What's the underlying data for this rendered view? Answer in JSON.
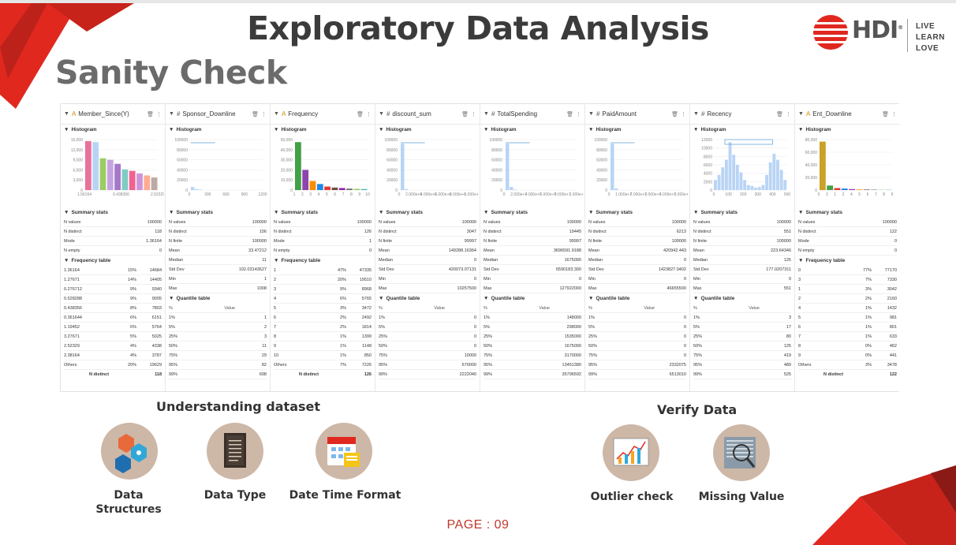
{
  "title": "Exploratory Data Analysis",
  "subtitle": "Sanity Check",
  "logo": {
    "brand": "HDI",
    "reg": "®",
    "slogan": [
      "LIVE",
      "LEARN",
      "LOVE"
    ]
  },
  "colors": {
    "accent_red": "#e0281f",
    "dark_red": "#8b1a16",
    "icon_bg": "#cdb7a7",
    "bar_blue": "#b8d4f5"
  },
  "labels": {
    "histogram": "Histogram",
    "summary_stats": "Summary stats",
    "frequency_table": "Frequency table",
    "quantile_table": "Quantile table",
    "pct_header": "%",
    "value_header": "Value",
    "n_distinct": "N distinct"
  },
  "columns": [
    {
      "name": "Member_Since(Y)",
      "type_icon": "A",
      "hist_ticks": [
        "1.56164",
        "0.438356",
        "2.52329"
      ],
      "y_ticks": [
        "15,000",
        "12,000",
        "9,000",
        "6,000",
        "3,000",
        "0"
      ],
      "summary": [
        [
          "N values",
          "100000"
        ],
        [
          "N distinct",
          "118"
        ],
        [
          "Mode",
          "1.36164"
        ],
        [
          "N empty",
          "0"
        ]
      ],
      "frequency": [
        [
          "1.36164",
          "15%",
          "14684"
        ],
        [
          "1.27671",
          "14%",
          "14405"
        ],
        [
          "0.276712",
          "9%",
          "9340"
        ],
        [
          "0.528288",
          "9%",
          "9005"
        ],
        [
          "0.438356",
          "8%",
          "7803"
        ],
        [
          "0.361644",
          "6%",
          "6151"
        ],
        [
          "1.19452",
          "6%",
          "5764"
        ],
        [
          "3.27671",
          "5%",
          "5025"
        ],
        [
          "2.52329",
          "4%",
          "4338"
        ],
        [
          "2.38164",
          "4%",
          "3787"
        ],
        [
          "Others",
          "20%",
          "19629"
        ]
      ],
      "freq_total": "118"
    },
    {
      "name": "Sponsor_Downline",
      "type_icon": "#",
      "hist_ticks": [
        "0",
        "300",
        "600",
        "900",
        "1200"
      ],
      "y_ticks": [
        "100000",
        "80000",
        "60000",
        "40000",
        "20000",
        "0"
      ],
      "summary": [
        [
          "N values",
          "100000"
        ],
        [
          "N distinct",
          "156"
        ],
        [
          "N finite",
          "100000"
        ],
        [
          "Mean",
          "33.47212"
        ],
        [
          "Median",
          "11"
        ],
        [
          "Std Dev",
          "102.03143627"
        ],
        [
          "Min",
          "1"
        ],
        [
          "Max",
          "1008"
        ]
      ],
      "quantiles": [
        [
          "1%",
          "1"
        ],
        [
          "5%",
          "2"
        ],
        [
          "25%",
          "3"
        ],
        [
          "50%",
          "11"
        ],
        [
          "75%",
          "29"
        ],
        [
          "95%",
          "82"
        ],
        [
          "99%",
          "698"
        ]
      ]
    },
    {
      "name": "Frequency",
      "type_icon": "A",
      "hist_ticks": [
        "1",
        "2",
        "3",
        "4",
        "5",
        "6",
        "7",
        "8",
        "9",
        "10"
      ],
      "y_ticks": [
        "50,000",
        "40,000",
        "30,000",
        "20,000",
        "10,000",
        "0"
      ],
      "summary": [
        [
          "N values",
          "100000"
        ],
        [
          "N distinct",
          "126"
        ],
        [
          "Mode",
          "1"
        ],
        [
          "N empty",
          "0"
        ]
      ],
      "frequency": [
        [
          "1",
          "47%",
          "47335"
        ],
        [
          "2",
          "20%",
          "19510"
        ],
        [
          "3",
          "9%",
          "8968"
        ],
        [
          "4",
          "6%",
          "5765"
        ],
        [
          "5",
          "3%",
          "3472"
        ],
        [
          "6",
          "2%",
          "2492"
        ],
        [
          "7",
          "2%",
          "1814"
        ],
        [
          "8",
          "1%",
          "1399"
        ],
        [
          "9",
          "1%",
          "1148"
        ],
        [
          "10",
          "1%",
          "850"
        ],
        [
          "Others",
          "7%",
          "7226"
        ]
      ],
      "freq_total": "126"
    },
    {
      "name": "discount_sum",
      "type_icon": "#",
      "hist_ticks": [
        "0",
        "2.000e+6",
        "4.000e+6",
        "6.000e+6",
        "8.000e+6",
        "1.000e+7"
      ],
      "y_ticks": [
        "100000",
        "80000",
        "60000",
        "40000",
        "20000",
        "0"
      ],
      "summary": [
        [
          "N values",
          "100000"
        ],
        [
          "N distinct",
          "3047"
        ],
        [
          "N finite",
          "99997"
        ],
        [
          "Mean",
          "149288.16364"
        ],
        [
          "Median",
          "0"
        ],
        [
          "Std Dev",
          "420073.07131"
        ],
        [
          "Min",
          "0"
        ],
        [
          "Max",
          "10257500"
        ]
      ],
      "quantiles": [
        [
          "1%",
          "0"
        ],
        [
          "5%",
          "0"
        ],
        [
          "25%",
          "0"
        ],
        [
          "50%",
          "0"
        ],
        [
          "75%",
          "10000"
        ],
        [
          "95%",
          "670000"
        ],
        [
          "99%",
          "2222040"
        ]
      ]
    },
    {
      "name": "TotalSpending",
      "type_icon": "#",
      "hist_ticks": [
        "0",
        "2.000e+7",
        "4.000e+7",
        "6.000e+7",
        "8.000e+7",
        "1.000e+8"
      ],
      "y_ticks": [
        "100000",
        "80000",
        "60000",
        "40000",
        "20000",
        "0"
      ],
      "summary": [
        [
          "N values",
          "100000"
        ],
        [
          "N distinct",
          "19445"
        ],
        [
          "N finite",
          "99997"
        ],
        [
          "Mean",
          "3696591.9188"
        ],
        [
          "Median",
          "1675000"
        ],
        [
          "Std Dev",
          "6590183.300"
        ],
        [
          "Min",
          "0"
        ],
        [
          "Max",
          "127922000"
        ]
      ],
      "quantiles": [
        [
          "1%",
          "148000"
        ],
        [
          "5%",
          "298000"
        ],
        [
          "25%",
          "1535000"
        ],
        [
          "50%",
          "1675000"
        ],
        [
          "75%",
          "3170000"
        ],
        [
          "95%",
          "13451380"
        ],
        [
          "99%",
          "35796592"
        ]
      ]
    },
    {
      "name": "PaidAmount",
      "type_icon": "#",
      "hist_ticks": [
        "0",
        "1.000e+7",
        "2.000e+7",
        "3.000e+7",
        "4.000e+7",
        "5.000e+7"
      ],
      "y_ticks": [
        "100000",
        "80000",
        "60000",
        "40000",
        "20000",
        "0"
      ],
      "summary": [
        [
          "N values",
          "100000"
        ],
        [
          "N distinct",
          "6213"
        ],
        [
          "N finite",
          "100000"
        ],
        [
          "Mean",
          "420942.443"
        ],
        [
          "Median",
          "0"
        ],
        [
          "Std Dev",
          "1423827.0402"
        ],
        [
          "Min",
          "0"
        ],
        [
          "Max",
          "46655500"
        ]
      ],
      "quantiles": [
        [
          "1%",
          "0"
        ],
        [
          "5%",
          "0"
        ],
        [
          "25%",
          "0"
        ],
        [
          "50%",
          "0"
        ],
        [
          "75%",
          "0"
        ],
        [
          "95%",
          "2332075"
        ],
        [
          "99%",
          "6513010"
        ]
      ]
    },
    {
      "name": "Recency",
      "type_icon": "#",
      "hist_ticks": [
        "0",
        "100",
        "200",
        "300",
        "400",
        "500"
      ],
      "y_ticks": [
        "12000",
        "10000",
        "8000",
        "6000",
        "4000",
        "2000",
        "0"
      ],
      "summary": [
        [
          "N values",
          "100000"
        ],
        [
          "N distinct",
          "551"
        ],
        [
          "N finite",
          "100000"
        ],
        [
          "Mean",
          "223.64346"
        ],
        [
          "Median",
          "125"
        ],
        [
          "Std Dev",
          "177.0207311"
        ],
        [
          "Min",
          "0"
        ],
        [
          "Max",
          "551"
        ]
      ],
      "quantiles": [
        [
          "1%",
          "3"
        ],
        [
          "5%",
          "17"
        ],
        [
          "25%",
          "80"
        ],
        [
          "50%",
          "125"
        ],
        [
          "75%",
          "419"
        ],
        [
          "95%",
          "489"
        ],
        [
          "99%",
          "525"
        ]
      ]
    },
    {
      "name": "Ent_Downline",
      "type_icon": "A",
      "hist_ticks": [
        "0",
        "3",
        "1",
        "2",
        "4",
        "5",
        "6",
        "7",
        "8",
        "9"
      ],
      "y_ticks": [
        "80,000",
        "60,000",
        "40,000",
        "20,000",
        "0"
      ],
      "summary": [
        [
          "N values",
          "100000"
        ],
        [
          "N distinct",
          "122"
        ],
        [
          "Mode",
          "0"
        ],
        [
          "N empty",
          "0"
        ]
      ],
      "frequency": [
        [
          "0",
          "77%",
          "77170"
        ],
        [
          "3",
          "7%",
          "7330"
        ],
        [
          "1",
          "3%",
          "3042"
        ],
        [
          "2",
          "2%",
          "2160"
        ],
        [
          "4",
          "1%",
          "1432"
        ],
        [
          "5",
          "1%",
          "981"
        ],
        [
          "6",
          "1%",
          "801"
        ],
        [
          "7",
          "1%",
          "633"
        ],
        [
          "8",
          "0%",
          "462"
        ],
        [
          "9",
          "0%",
          "441"
        ],
        [
          "Others",
          "3%",
          "3478"
        ]
      ],
      "freq_total": "122"
    }
  ],
  "sections": {
    "understanding": {
      "title": "Understanding dataset",
      "items": [
        {
          "label": "Data Structures",
          "icon": "hexagon-structures-icon"
        },
        {
          "label": "Data Type",
          "icon": "document-list-icon"
        },
        {
          "label": "Date Time Format",
          "icon": "calendar-icon"
        }
      ]
    },
    "verify": {
      "title": "Verify Data",
      "items": [
        {
          "label": "Outlier check",
          "icon": "chart-outlier-icon"
        },
        {
          "label": "Missing Value",
          "icon": "magnifier-document-icon"
        }
      ]
    }
  },
  "page_label": "PAGE : 09"
}
